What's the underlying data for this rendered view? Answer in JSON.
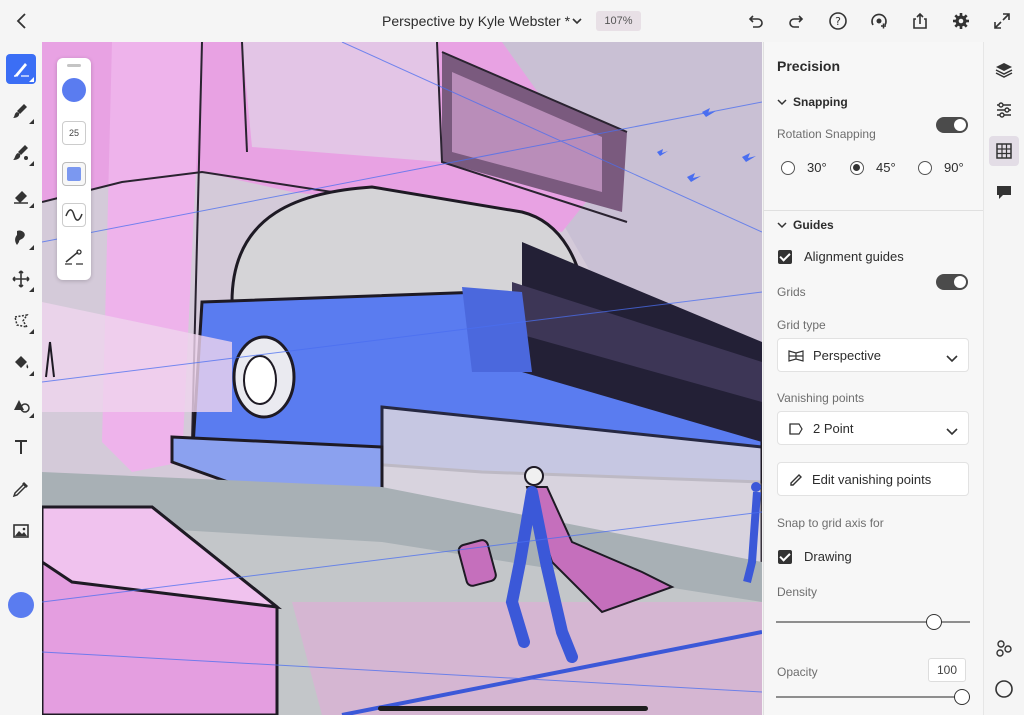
{
  "app": {
    "document_title": "Perspective by Kyle Webster *",
    "zoom": "107%"
  },
  "float_bar": {
    "brush_size": "25"
  },
  "panel": {
    "title": "Precision",
    "snapping": {
      "header": "Snapping",
      "rotation_label": "Rotation Snapping",
      "rotation_enabled": true,
      "angles": [
        "30°",
        "45°",
        "90°"
      ],
      "selected_angle": "45°"
    },
    "guides": {
      "header": "Guides",
      "alignment_label": "Alignment guides",
      "alignment_checked": true,
      "grids_label": "Grids",
      "grids_enabled": true,
      "grid_type_label": "Grid type",
      "grid_type_value": "Perspective",
      "vanishing_label": "Vanishing points",
      "vanishing_value": "2 Point",
      "edit_button": "Edit vanishing points",
      "snap_label": "Snap to grid axis for",
      "drawing_label": "Drawing",
      "drawing_checked": true,
      "density_label": "Density",
      "density_value_fraction": 0.82,
      "opacity_label": "Opacity",
      "opacity_value": "100",
      "opacity_value_fraction": 1.0
    }
  },
  "colors": {
    "accent": "#3b6ef5",
    "brush_color": "#5a7cf0",
    "canvas_pink": "#e3a6e0",
    "canvas_blue": "#5a7cf0"
  }
}
